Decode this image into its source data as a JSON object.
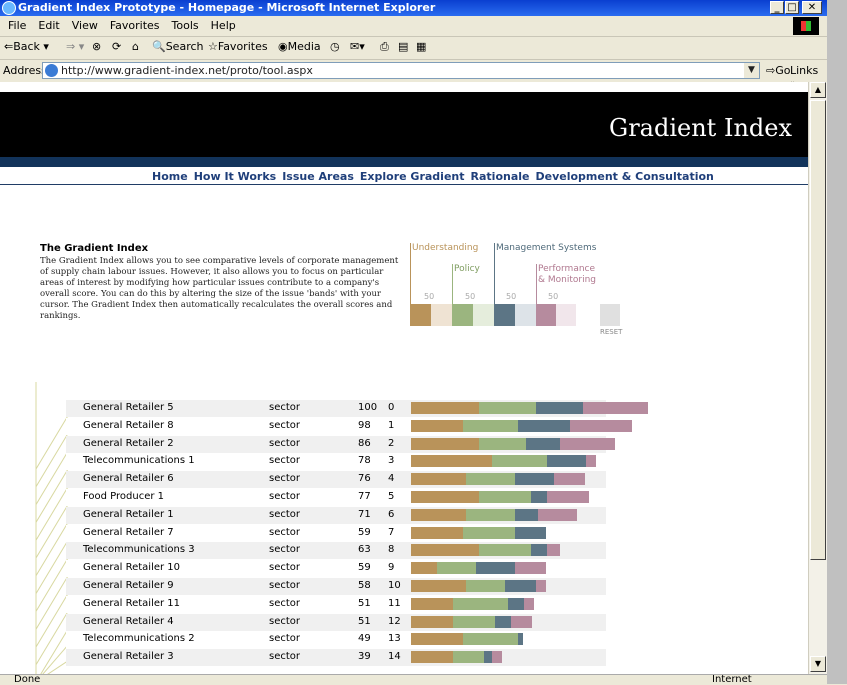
{
  "window": {
    "title": "Gradient Index Prototype - Homepage - Microsoft Internet Explorer",
    "min": "_",
    "max": "□",
    "close": "✕"
  },
  "menu": [
    "File",
    "Edit",
    "View",
    "Favorites",
    "Tools",
    "Help"
  ],
  "toolbar": {
    "back": "Back",
    "search": "Search",
    "favorites": "Favorites",
    "media": "Media"
  },
  "address": {
    "label": "Address",
    "url": "http://www.gradient-index.net/proto/tool.aspx",
    "go": "Go",
    "links": "Links"
  },
  "status": {
    "left": "Done",
    "right": "Internet"
  },
  "site": {
    "title": "Gradient Index",
    "nav": [
      "Home",
      "How It Works",
      "Issue Areas",
      "Explore Gradient",
      "Rationale",
      "Development & Consultation"
    ],
    "intro_title": "The Gradient Index",
    "intro_text": "The Gradient Index allows you to see comparative levels of corporate management of supply chain labour issues. However, it also allows you to focus on particular areas of interest by modifying how particular issues contribute to a company's overall score. You can do this by altering the size of the issue 'bands' with your cursor. The Gradient Index then automatically recalculates the overall scores and rankings."
  },
  "controls": {
    "labels": [
      "Understanding",
      "Policy",
      "Management Systems",
      "Performance",
      "& Monitoring"
    ],
    "values": [
      "50",
      "50",
      "50",
      "50"
    ],
    "reset": "RESET",
    "colors": {
      "understanding": "#b9935a",
      "policy": "#9bb57f",
      "management": "#5c7585",
      "performance": "#b68b9e"
    }
  },
  "results": [
    {
      "name": "General Retailer 5",
      "sector": "sector",
      "score": "100",
      "rank": "0",
      "bands": [
        0.26,
        0.22,
        0.18,
        0.25
      ]
    },
    {
      "name": "General Retailer 8",
      "sector": "sector",
      "score": "98",
      "rank": "1",
      "bands": [
        0.2,
        0.21,
        0.2,
        0.24
      ]
    },
    {
      "name": "General Retailer 2",
      "sector": "sector",
      "score": "86",
      "rank": "2",
      "bands": [
        0.26,
        0.18,
        0.13,
        0.21
      ]
    },
    {
      "name": "Telecommunications 1",
      "sector": "sector",
      "score": "78",
      "rank": "3",
      "bands": [
        0.31,
        0.21,
        0.15,
        0.04
      ]
    },
    {
      "name": "General Retailer 6",
      "sector": "sector",
      "score": "76",
      "rank": "4",
      "bands": [
        0.21,
        0.19,
        0.15,
        0.12
      ]
    },
    {
      "name": "Food Producer 1",
      "sector": "sector",
      "score": "77",
      "rank": "5",
      "bands": [
        0.26,
        0.2,
        0.06,
        0.16
      ]
    },
    {
      "name": "General Retailer 1",
      "sector": "sector",
      "score": "71",
      "rank": "6",
      "bands": [
        0.21,
        0.19,
        0.09,
        0.15
      ]
    },
    {
      "name": "General Retailer 7",
      "sector": "sector",
      "score": "59",
      "rank": "7",
      "bands": [
        0.2,
        0.2,
        0.12,
        0.0
      ]
    },
    {
      "name": "Telecommunications 3",
      "sector": "sector",
      "score": "63",
      "rank": "8",
      "bands": [
        0.26,
        0.2,
        0.06,
        0.05
      ]
    },
    {
      "name": "General Retailer 10",
      "sector": "sector",
      "score": "59",
      "rank": "9",
      "bands": [
        0.1,
        0.15,
        0.15,
        0.12
      ]
    },
    {
      "name": "General Retailer 9",
      "sector": "sector",
      "score": "58",
      "rank": "10",
      "bands": [
        0.21,
        0.15,
        0.12,
        0.04
      ]
    },
    {
      "name": "General Retailer 11",
      "sector": "sector",
      "score": "51",
      "rank": "11",
      "bands": [
        0.16,
        0.21,
        0.06,
        0.04
      ]
    },
    {
      "name": "General Retailer 4",
      "sector": "sector",
      "score": "51",
      "rank": "12",
      "bands": [
        0.16,
        0.16,
        0.06,
        0.08
      ]
    },
    {
      "name": "Telecommunications 2",
      "sector": "sector",
      "score": "49",
      "rank": "13",
      "bands": [
        0.2,
        0.21,
        0.02,
        0.0
      ]
    },
    {
      "name": "General Retailer 3",
      "sector": "sector",
      "score": "39",
      "rank": "14",
      "bands": [
        0.16,
        0.12,
        0.03,
        0.04
      ]
    }
  ]
}
